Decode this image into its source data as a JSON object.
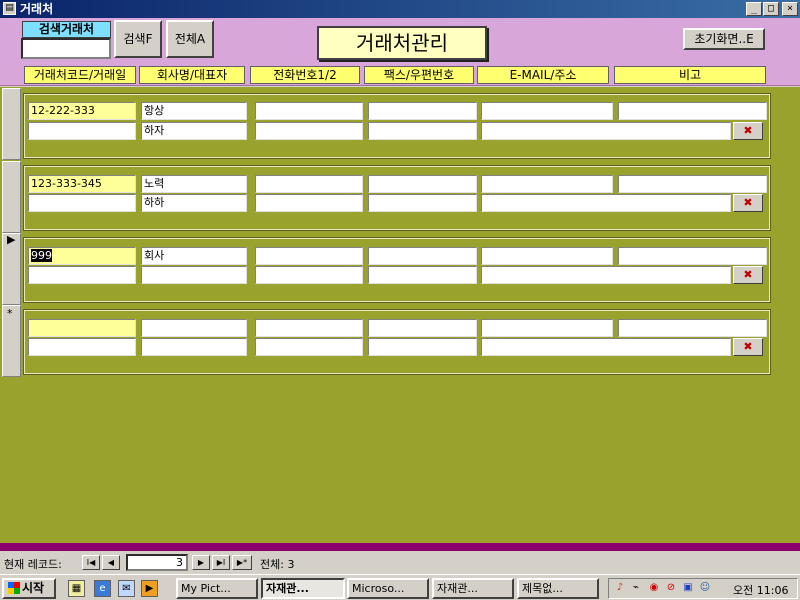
{
  "window": {
    "title": "거래처",
    "min": "_",
    "max": "□",
    "close": "×"
  },
  "header": {
    "search_label": "검색거래처",
    "search_value": "",
    "search_button": "검색F",
    "all_button": "전체A",
    "form_title": "거래처관리",
    "home_button": "초기화면..E"
  },
  "columns": [
    "거래처코드/거래일",
    "회사명/대표자",
    "전화번호1/2",
    "팩스/우편번호",
    "E-MAIL/주소",
    "비고"
  ],
  "records": [
    {
      "code": "12-222-333",
      "company": "항상",
      "rep": "하자"
    },
    {
      "code": "123-333-345",
      "company": "노력",
      "rep": "하하"
    },
    {
      "code": "999",
      "company": "회사",
      "rep": ""
    },
    {
      "code": "",
      "company": "",
      "rep": ""
    }
  ],
  "record_selectors": [
    "",
    "",
    "▶",
    "*"
  ],
  "delete_icon": "delete-record-icon",
  "navigator": {
    "label": "현재 레코드:",
    "current": "3",
    "total": "전체: 3",
    "first": "I◀",
    "prev": "◀",
    "next": "▶",
    "last": "▶I",
    "new": "▶*"
  },
  "taskbar": {
    "start": "시작",
    "tasks": [
      "My Pict...",
      "자재관...",
      "Microso...",
      "자재관...",
      "제목없..."
    ],
    "clock": "오전 11:06"
  },
  "colors": {
    "detail_bg": "#99a22c",
    "header_bg": "#d8a6d8",
    "key_field": "#ffff99"
  }
}
